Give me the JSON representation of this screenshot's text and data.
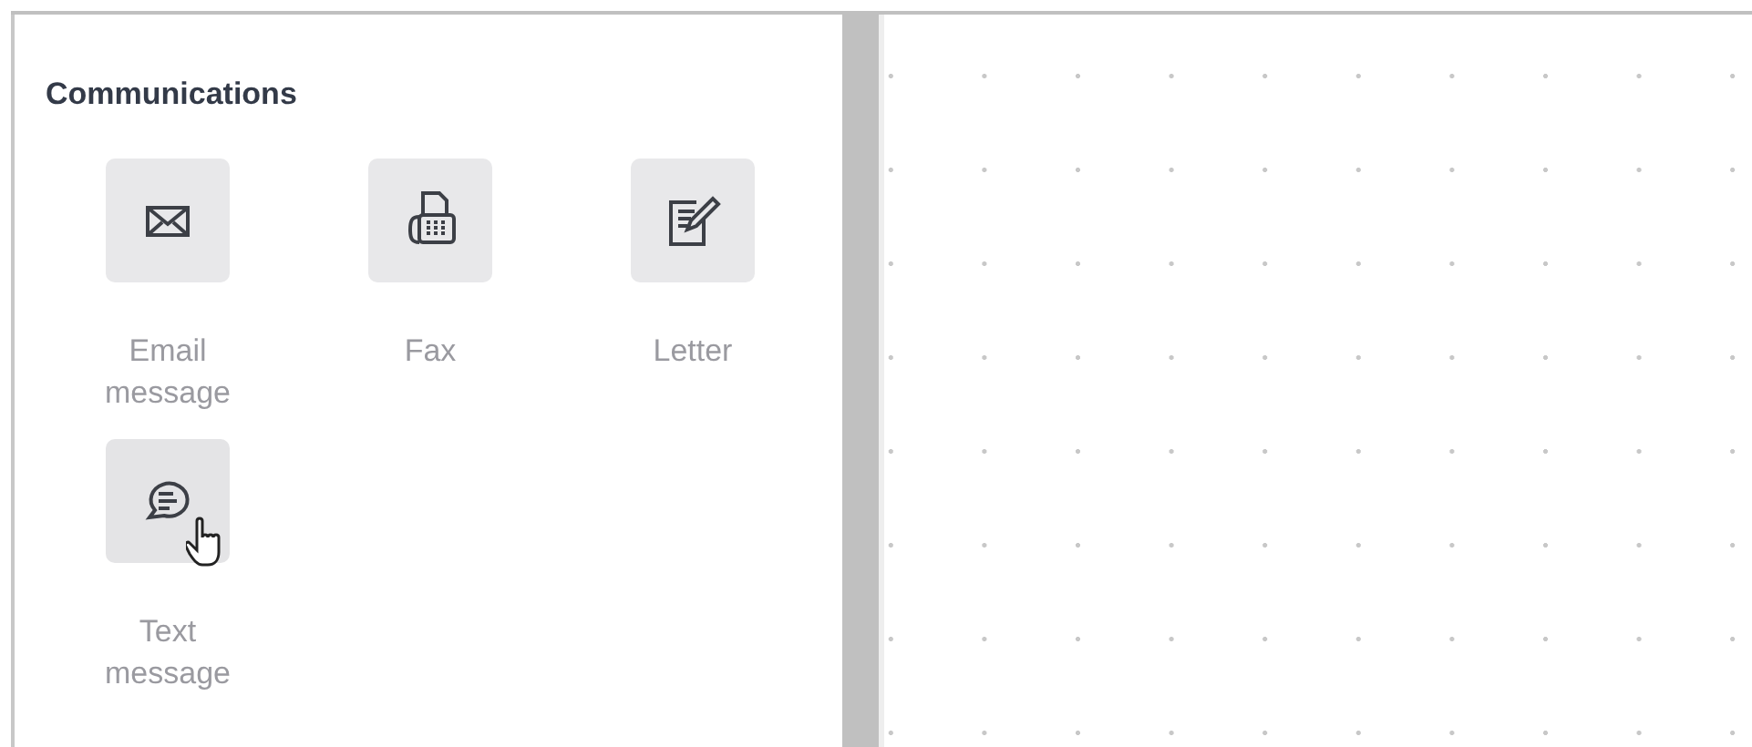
{
  "panel": {
    "title": "Communications",
    "items": [
      {
        "label": "Email message",
        "hovered": false
      },
      {
        "label": "Fax",
        "hovered": false
      },
      {
        "label": "Letter",
        "hovered": false
      },
      {
        "label": "Text message",
        "hovered": true
      }
    ]
  }
}
